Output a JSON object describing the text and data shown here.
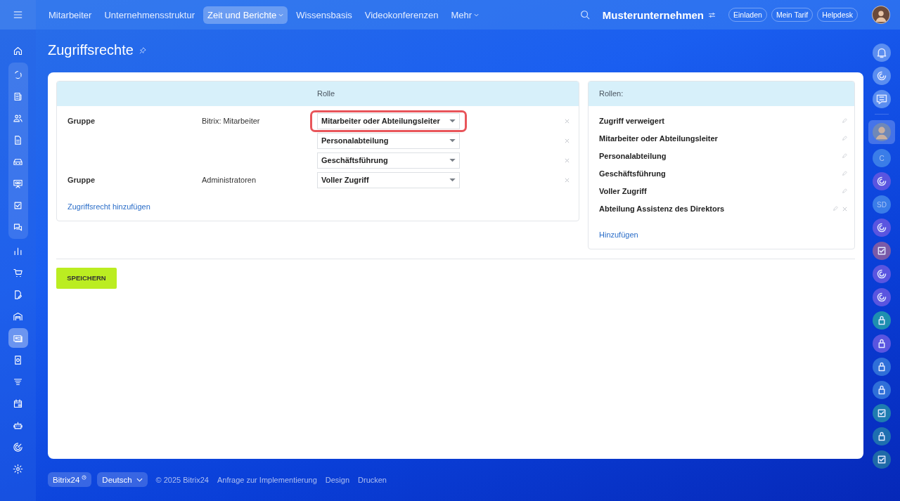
{
  "top_nav": {
    "items": [
      {
        "label": "Mitarbeiter",
        "selected": false,
        "has_menu": false
      },
      {
        "label": "Unternehmensstruktur",
        "selected": false,
        "has_menu": false
      },
      {
        "label": "Zeit und Berichte",
        "selected": true,
        "has_menu": true
      },
      {
        "label": "Wissensbasis",
        "selected": false,
        "has_menu": false
      },
      {
        "label": "Videokonferenzen",
        "selected": false,
        "has_menu": false
      },
      {
        "label": "Mehr",
        "selected": false,
        "has_menu": true
      }
    ],
    "company": "Musterunternehmen",
    "buttons": [
      "Einladen",
      "Mein Tarif",
      "Helpdesk"
    ]
  },
  "sidebar": {
    "sections": [
      {
        "grouped": false,
        "items": [
          {
            "selected": false
          }
        ]
      },
      {
        "grouped": true,
        "items": [
          {
            "selected": false
          },
          {
            "selected": false
          },
          {
            "selected": false
          },
          {
            "selected": false
          },
          {
            "selected": false
          },
          {
            "selected": false
          },
          {
            "selected": false
          },
          {
            "selected": false
          }
        ]
      },
      {
        "grouped": false,
        "items": [
          {
            "selected": false
          },
          {
            "selected": false
          },
          {
            "selected": false
          },
          {
            "selected": false
          },
          {
            "selected": true
          },
          {
            "selected": false
          },
          {
            "selected": false
          },
          {
            "selected": false
          },
          {
            "selected": false
          },
          {
            "selected": false
          },
          {
            "selected": false
          }
        ]
      }
    ]
  },
  "right_bar": {
    "items": [
      {
        "kind": "icon"
      },
      {
        "kind": "icon"
      },
      {
        "kind": "icon"
      },
      {
        "kind": "divider"
      },
      {
        "kind": "avatar"
      },
      {
        "kind": "letters",
        "text": "C"
      },
      {
        "kind": "icon"
      },
      {
        "kind": "letters",
        "text": "SD"
      },
      {
        "kind": "icon"
      },
      {
        "kind": "icon"
      },
      {
        "kind": "icon"
      },
      {
        "kind": "icon"
      },
      {
        "kind": "icon"
      },
      {
        "kind": "icon"
      },
      {
        "kind": "icon"
      },
      {
        "kind": "icon"
      },
      {
        "kind": "icon"
      },
      {
        "kind": "icon"
      },
      {
        "kind": "icon"
      }
    ]
  },
  "page_title": "Zugriffsrechte",
  "access_table": {
    "header": "Rolle",
    "rows": [
      {
        "type": "Gruppe",
        "name": "Bitrix: Mitarbeiter",
        "roles": [
          {
            "label": "Mitarbeiter oder Abteilungsleiter",
            "highlighted": true
          },
          {
            "label": "Personalabteilung",
            "highlighted": false
          },
          {
            "label": "Geschäftsführung",
            "highlighted": false
          }
        ]
      },
      {
        "type": "Gruppe",
        "name": "Administratoren",
        "roles": [
          {
            "label": "Voller Zugriff",
            "highlighted": false
          }
        ]
      }
    ],
    "add_link": "Zugriffsrecht hinzufügen"
  },
  "roles_panel": {
    "header": "Rollen:",
    "roles": [
      {
        "label": "Zugriff verweigert",
        "deletable": false
      },
      {
        "label": "Mitarbeiter oder Abteilungsleiter",
        "deletable": false
      },
      {
        "label": "Personalabteilung",
        "deletable": false
      },
      {
        "label": "Geschäftsführung",
        "deletable": false
      },
      {
        "label": "Voller Zugriff",
        "deletable": false
      },
      {
        "label": "Abteilung Assistenz des Direktors",
        "deletable": true
      }
    ],
    "add_link": "Hinzufügen"
  },
  "save_button": "SPEICHERN",
  "footer": {
    "brand": "Bitrix24",
    "language": "Deutsch",
    "copyright": "© 2025 Bitrix24",
    "links": [
      "Anfrage zur Implementierung",
      "Design",
      "Drucken"
    ]
  }
}
